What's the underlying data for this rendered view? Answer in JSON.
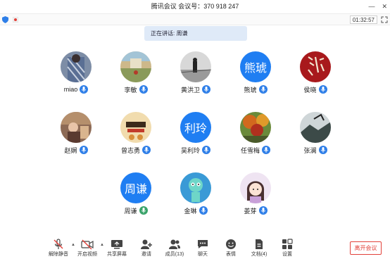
{
  "window": {
    "title": "腾讯会议  会议号：370 918 247"
  },
  "toolbar": {
    "timer": "01:32:57"
  },
  "speaking": {
    "text": "正在讲话: 周谦"
  },
  "participants": [
    {
      "name": "miao",
      "avatar_text": ""
    },
    {
      "name": "李敏",
      "avatar_text": ""
    },
    {
      "name": "黄洪卫",
      "avatar_text": ""
    },
    {
      "name": "熊琥",
      "avatar_text": "熊琥"
    },
    {
      "name": "侯晓",
      "avatar_text": ""
    },
    {
      "name": "赵娴",
      "avatar_text": ""
    },
    {
      "name": "曾志勇",
      "avatar_text": ""
    },
    {
      "name": "吴利玲",
      "avatar_text": "利玲"
    },
    {
      "name": "任雪梅",
      "avatar_text": ""
    },
    {
      "name": "张澜",
      "avatar_text": ""
    },
    {
      "name": "周谦",
      "avatar_text": "周谦"
    },
    {
      "name": "金琳",
      "avatar_text": ""
    },
    {
      "name": "姜芽",
      "avatar_text": ""
    }
  ],
  "bottom_toolbar": {
    "mute": "解除静音",
    "video": "开启视频",
    "share": "共享屏幕",
    "invite": "邀请",
    "members": "成员(13)",
    "chat": "聊天",
    "emoji": "表情",
    "docs": "文档(4)",
    "settings": "设置",
    "leave": "离开会议"
  },
  "colors": {
    "accent": "#1f7ef2",
    "leave": "#e2413a",
    "speaking_bg": "#dfeaf8"
  }
}
